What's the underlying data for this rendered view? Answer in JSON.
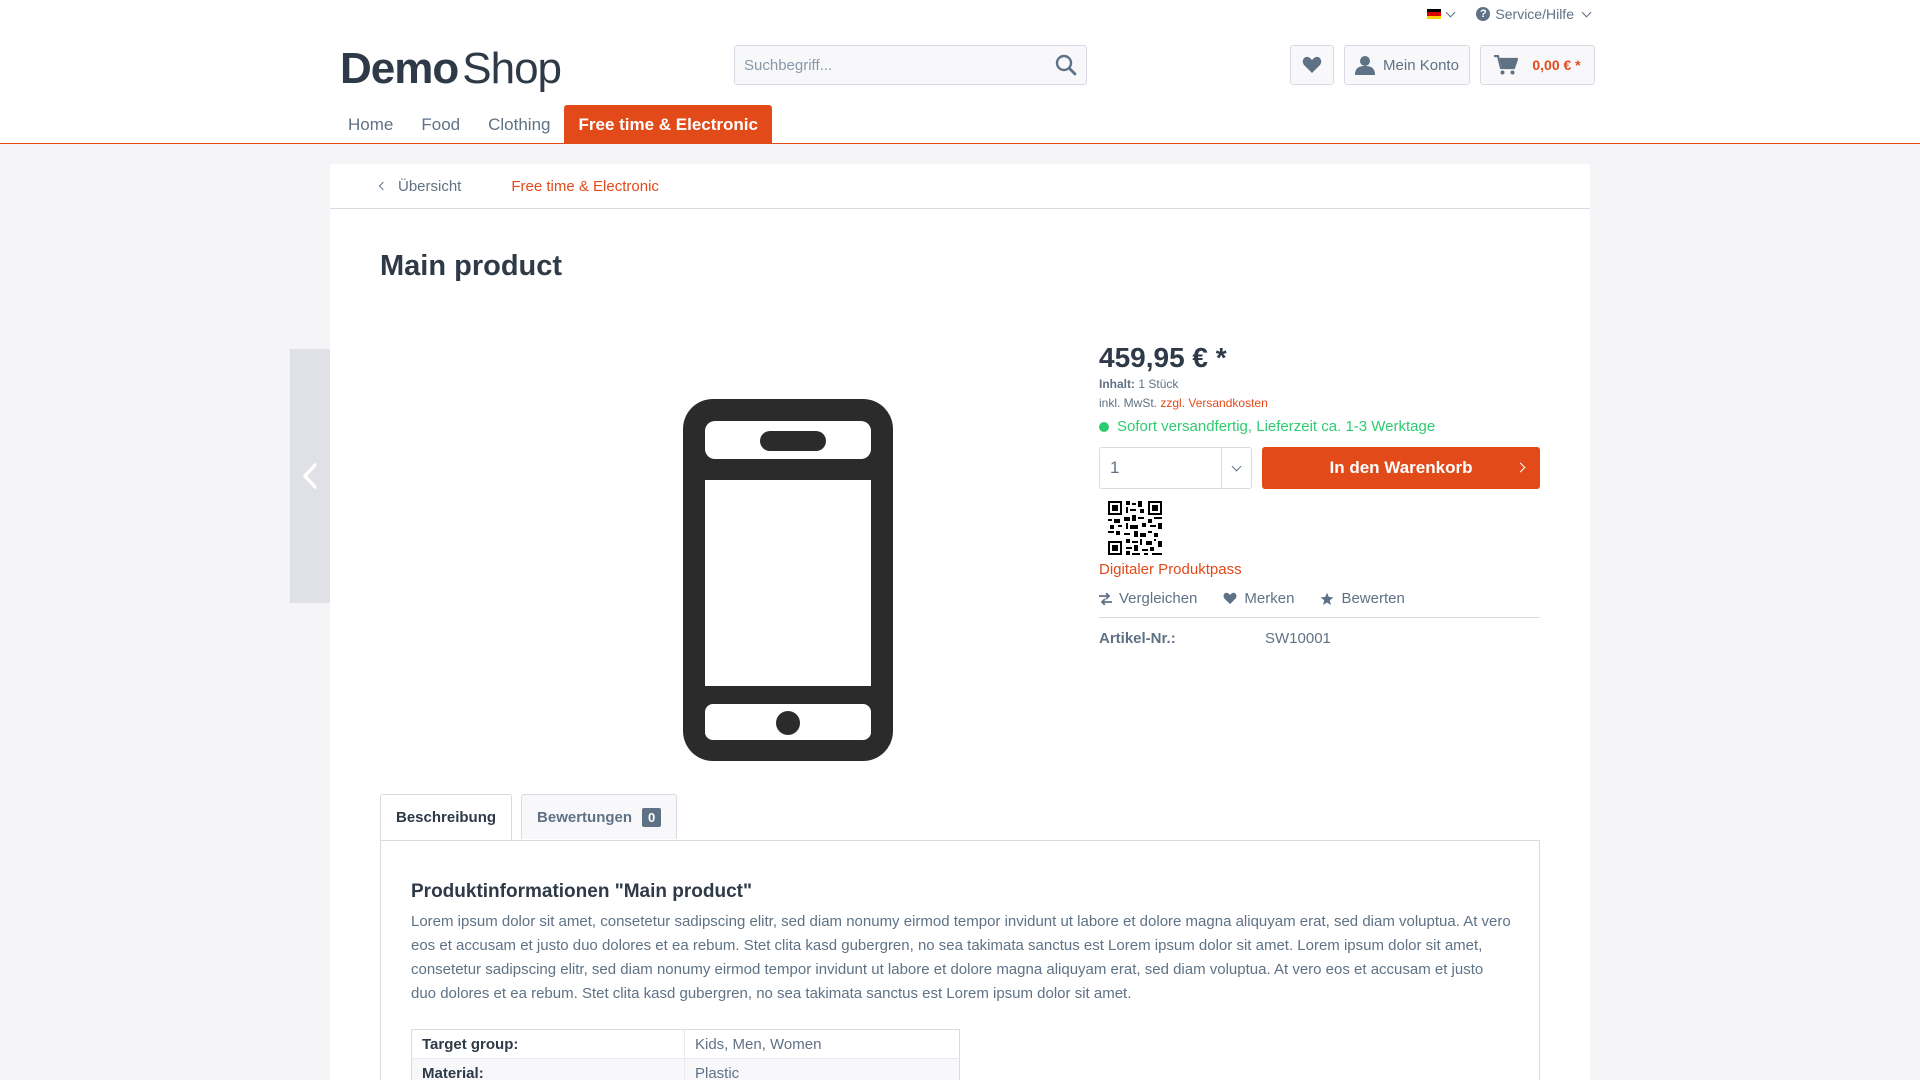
{
  "topbar": {
    "service_label": "Service/Hilfe",
    "flag_colors": [
      "#000000",
      "#dd0000",
      "#ffce00"
    ]
  },
  "logo": {
    "part1": "Demo",
    "part2": "Shop"
  },
  "search": {
    "placeholder": "Suchbegriff..."
  },
  "header_actions": {
    "account_label": "Mein Konto",
    "cart_amount": "0,00 € *"
  },
  "nav": {
    "items": [
      {
        "label": "Home"
      },
      {
        "label": "Food"
      },
      {
        "label": "Clothing"
      },
      {
        "label": "Free time & Electronic"
      }
    ]
  },
  "breadcrumb": {
    "back_label": "Übersicht",
    "category_label": "Free time & Electronic"
  },
  "product": {
    "title": "Main product",
    "price": "459,95 € *",
    "inhalt_label": "Inhalt:",
    "inhalt_value": "1 Stück",
    "tax_prefix": "inkl. MwSt.",
    "shipping_link": "zzgl. Versandkosten",
    "delivery": "Sofort versandfertig, Lieferzeit ca. 1-3 Werktage",
    "quantity": "1",
    "add_to_cart": "In den Warenkorb",
    "passport_link": "Digitaler Produktpass",
    "compare_label": "Vergleichen",
    "remember_label": "Merken",
    "rate_label": "Bewerten",
    "artnr_label": "Artikel-Nr.:",
    "artnr_value": "SW10001"
  },
  "tabs": {
    "description": "Beschreibung",
    "reviews": "Bewertungen",
    "reviews_count": "0"
  },
  "description": {
    "title": "Produktinformationen \"Main product\"",
    "text": "Lorem ipsum dolor sit amet, consetetur sadipscing elitr, sed diam nonumy eirmod tempor invidunt ut labore et dolore magna aliquyam erat, sed diam voluptua. At vero eos et accusam et justo duo dolores et ea rebum. Stet clita kasd gubergren, no sea takimata sanctus est Lorem ipsum dolor sit amet. Lorem ipsum dolor sit amet, consetetur sadipscing elitr, sed diam nonumy eirmod tempor invidunt ut labore et dolore magna aliquyam erat, sed diam voluptua. At vero eos et accusam et justo duo dolores et ea rebum. Stet clita kasd gubergren, no sea takimata sanctus est Lorem ipsum dolor sit amet.",
    "properties": [
      {
        "label": "Target group:",
        "value": "Kids, Men, Women"
      },
      {
        "label": "Material:",
        "value": "Plastic"
      }
    ]
  },
  "colors": {
    "accent": "#e34a19",
    "text": "#5f7285",
    "heading": "#2e3a47",
    "success": "#2ecc71"
  }
}
